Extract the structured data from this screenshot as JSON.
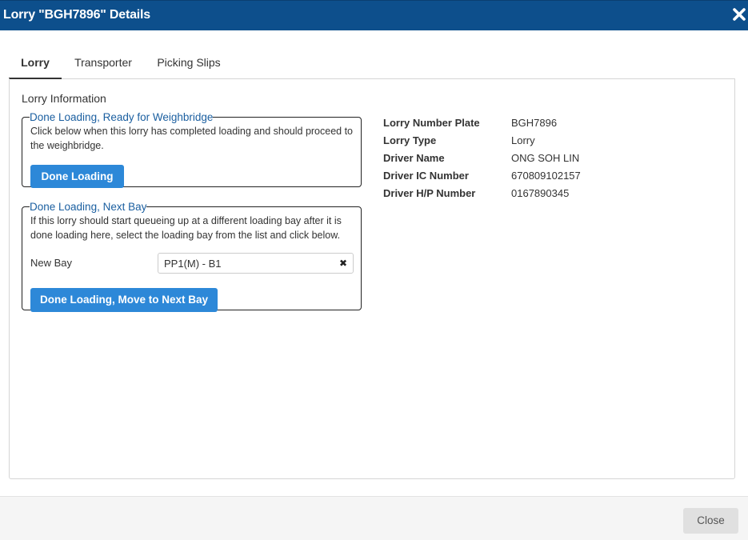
{
  "header": {
    "title": "Lorry \"BGH7896\" Details",
    "close_icon": "close-icon"
  },
  "tabs": [
    {
      "label": "Lorry",
      "active": true
    },
    {
      "label": "Transporter",
      "active": false
    },
    {
      "label": "Picking Slips",
      "active": false
    }
  ],
  "section_title": "Lorry Information",
  "weighbridge_box": {
    "legend": "Done Loading, Ready for Weighbridge",
    "description": "Click below when this lorry has completed loading and should proceed to the weighbridge.",
    "button_label": "Done Loading"
  },
  "next_bay_box": {
    "legend": "Done Loading, Next Bay",
    "description": "If this lorry should start queueing up at a different loading bay after it is done loading here, select the loading bay from the list and click below.",
    "new_bay_label": "New Bay",
    "new_bay_value": "PP1(M) - B1",
    "clear_icon": "clear-icon",
    "button_label": "Done Loading, Move to Next Bay"
  },
  "details": [
    {
      "label": "Lorry Number Plate",
      "value": "BGH7896"
    },
    {
      "label": "Lorry Type",
      "value": "Lorry"
    },
    {
      "label": "Driver Name",
      "value": "ONG SOH LIN"
    },
    {
      "label": "Driver IC Number",
      "value": "670809102157"
    },
    {
      "label": "Driver H/P Number",
      "value": "0167890345"
    }
  ],
  "footer": {
    "close_label": "Close"
  },
  "colors": {
    "header_bg": "#0d4f8c",
    "primary_button": "#2d88d8",
    "legend_text": "#1b5fa0"
  }
}
